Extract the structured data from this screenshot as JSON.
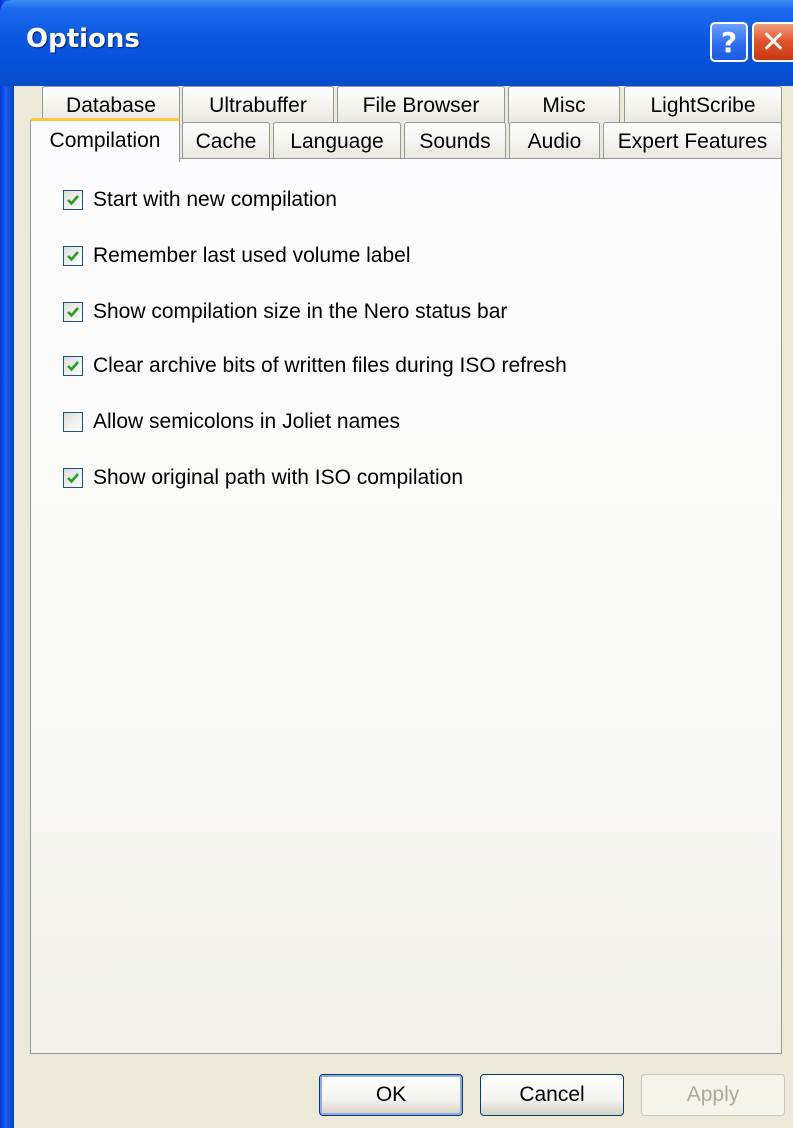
{
  "window": {
    "title": "Options",
    "help_symbol": "?",
    "close_symbol": "✕"
  },
  "tabs": {
    "row_top": [
      "Database",
      "Ultrabuffer",
      "File Browser",
      "Misc",
      "LightScribe"
    ],
    "row_bottom": [
      "Compilation",
      "Cache",
      "Language",
      "Sounds",
      "Audio",
      "Expert Features"
    ],
    "active": "Compilation"
  },
  "options": [
    {
      "label": "Start with new compilation",
      "checked": true
    },
    {
      "label": "Remember last used volume label",
      "checked": true
    },
    {
      "label": "Show compilation size in the Nero status bar",
      "checked": true
    },
    {
      "label": "Clear archive bits of written files during ISO refresh",
      "checked": true
    },
    {
      "label": "Allow semicolons in Joliet names",
      "checked": false
    },
    {
      "label": "Show original path with ISO compilation",
      "checked": true
    }
  ],
  "buttons": {
    "ok": "OK",
    "cancel": "Cancel",
    "apply": "Apply"
  },
  "colors": {
    "titlebar": "#0A58E0",
    "check": "#21A121",
    "tab_highlight": "#FFC83C"
  }
}
